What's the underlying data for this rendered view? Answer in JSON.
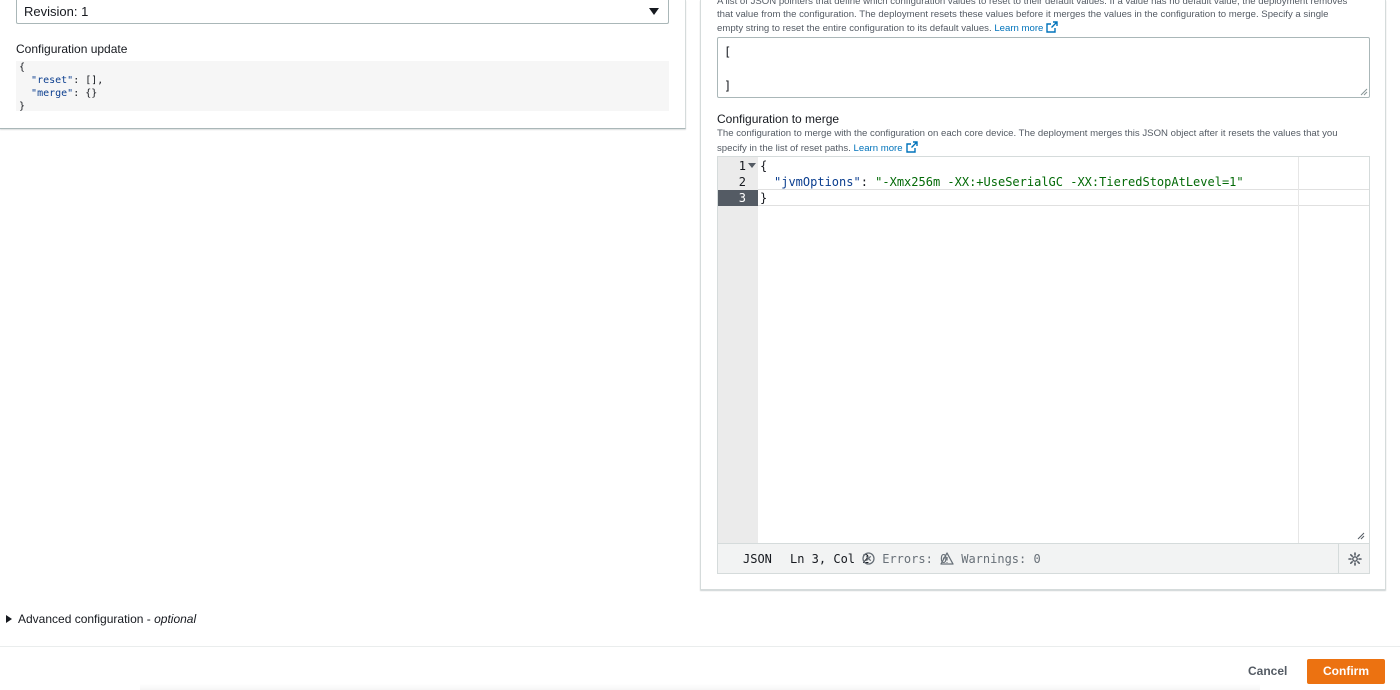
{
  "left": {
    "revision_select": "Revision: 1",
    "config_update_label": "Configuration update",
    "config_update_lines": {
      "l1": "{",
      "l2_key": "\"reset\"",
      "l2_rest": ": [],",
      "l3_key": "\"merge\"",
      "l3_rest": ": {}",
      "l4": "}"
    }
  },
  "right": {
    "reset_desc_line1": "A list of JSON pointers that define which configuration values to reset to their default values. If a value has no default value, the deployment removes",
    "reset_desc_line2": "that value from the configuration. The deployment resets these values before it merges the values in the configuration to merge. Specify a single",
    "reset_desc_line3": "empty string to reset the entire configuration to its default values.",
    "learn_more": "Learn more",
    "reset_value_open": "[",
    "reset_value_close": "]",
    "merge_label": "Configuration to merge",
    "merge_desc_line1": "The configuration to merge with the configuration on each core device. The deployment merges this JSON object after it resets the values that you",
    "merge_desc_line2": "specify in the list of reset paths.",
    "editor": {
      "gutter": [
        "1",
        "2",
        "3"
      ],
      "line1": "{",
      "line2_key": "\"jvmOptions\"",
      "line2_sep": ": ",
      "line2_value": "\"-Xmx256m -XX:+UseSerialGC -XX:TieredStopAtLevel=1\"",
      "line3": "}"
    },
    "status_bar": {
      "language": "JSON",
      "position": "Ln 3, Col 2",
      "errors": "Errors: 0",
      "warnings": "Warnings: 0"
    }
  },
  "advanced": {
    "label": "Advanced configuration - ",
    "optional": "optional"
  },
  "footer": {
    "cancel": "Cancel",
    "confirm": "Confirm"
  },
  "colors": {
    "primary_button": "#ec7211",
    "link": "#0073bb"
  }
}
